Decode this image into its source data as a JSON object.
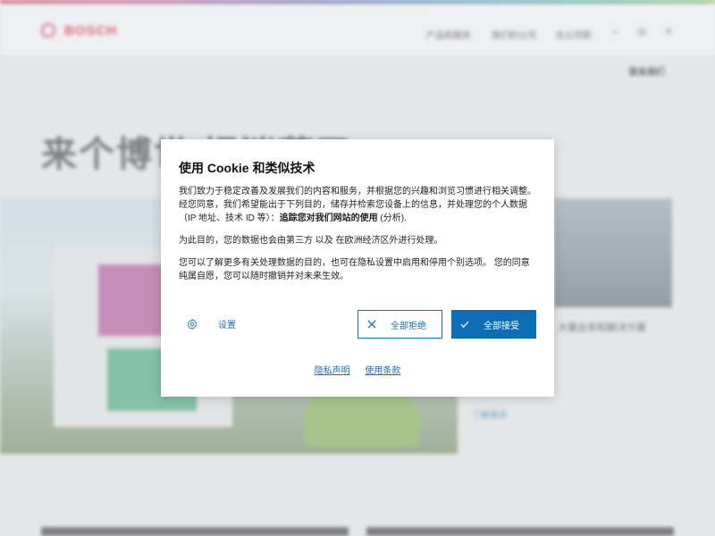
{
  "background": {
    "brand": "BOSCH",
    "nav": [
      "产品和服务",
      "我们的公司",
      "在公司职"
    ],
    "contact_label": "联系我们",
    "headline": "来个博世 捉迷藏了",
    "side_caption": "大量业务和解决方案",
    "learn_more": "了解更多"
  },
  "cookie_dialog": {
    "title": "使用 Cookie 和类似技术",
    "paragraph1_a": "我们致力于稳定改善及发展我们的内容和服务，并根据您的兴趣和浏览习惯进行相关调整。 经您同意，我们希望能出于下列目的，储存并检索您设备上的信息，并处理您的个人数据（IP 地址、技术 ID 等）：",
    "paragraph1_bold": "追踪您对我们网站的使用",
    "paragraph1_c": " (分析).",
    "paragraph2": "为此目的，您的数据也会由第三方 以及 在欧洲经济区外进行处理。",
    "paragraph3": "您可以了解更多有关处理数据的目的，也可在隐私设置中启用和停用个别选项。 您的同意纯属自愿，您可以随时撤销并对未来生效。",
    "settings_label": "设置",
    "reject_label": "全部拒绝",
    "accept_label": "全部接受",
    "privacy_link": "隐私声明",
    "terms_link": "使用条款"
  },
  "colors": {
    "accent": "#0a6fb5",
    "brand_red": "#e20015",
    "link": "#1e6fb8"
  }
}
